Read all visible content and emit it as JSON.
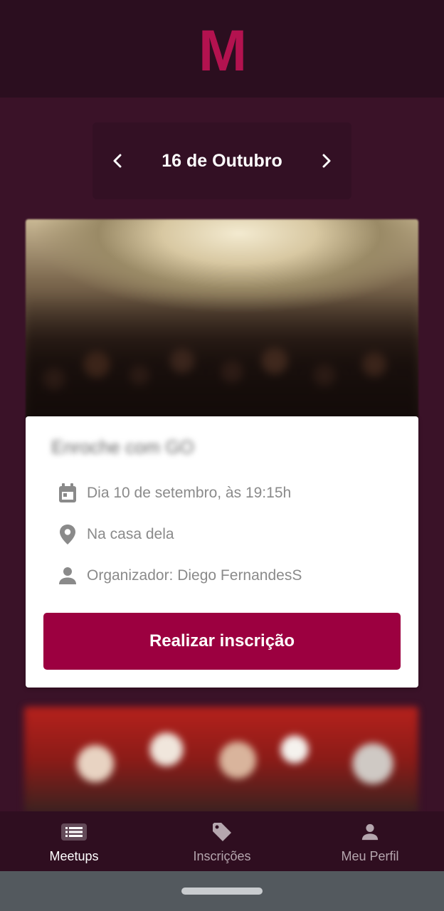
{
  "app": {
    "logo_letter": "M",
    "brand_color": "#9c0040"
  },
  "date_nav": {
    "current_date": "16 de Outubro",
    "prev_icon": "chevron-left-icon",
    "next_icon": "chevron-right-icon"
  },
  "meetup_card": {
    "title": "Enroche com GO",
    "date_text": "Dia 10 de setembro, às 19:15h",
    "location_text": "Na casa dela",
    "organizer_text": "Organizador: Diego FernandesS",
    "subscribe_label": "Realizar inscrição"
  },
  "bottom_nav": {
    "items": [
      {
        "label": "Meetups",
        "icon": "list-icon",
        "active": true
      },
      {
        "label": "Inscrições",
        "icon": "tag-icon",
        "active": false
      },
      {
        "label": "Meu Perfil",
        "icon": "person-icon",
        "active": false
      }
    ]
  }
}
